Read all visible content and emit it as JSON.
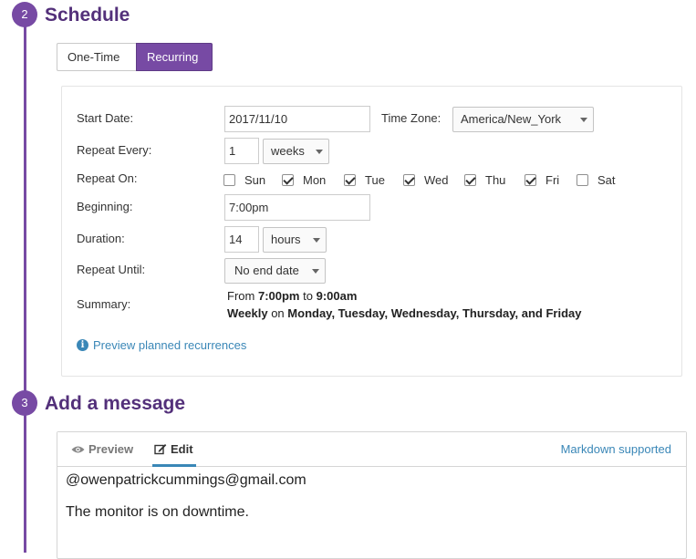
{
  "steps": {
    "schedule": {
      "number": "2",
      "title": "Schedule"
    },
    "message": {
      "number": "3",
      "title": "Add a message"
    }
  },
  "schedule_type": {
    "options": [
      "One-Time",
      "Recurring"
    ],
    "selected": "Recurring"
  },
  "form": {
    "start_date": {
      "label": "Start Date:",
      "value": "2017/11/10"
    },
    "time_zone": {
      "label": "Time Zone:",
      "value": "America/New_York"
    },
    "repeat_every": {
      "label": "Repeat Every:",
      "value": "1",
      "unit": "weeks"
    },
    "repeat_on": {
      "label": "Repeat On:",
      "days": [
        {
          "label": "Sun",
          "checked": false
        },
        {
          "label": "Mon",
          "checked": true
        },
        {
          "label": "Tue",
          "checked": true
        },
        {
          "label": "Wed",
          "checked": true
        },
        {
          "label": "Thu",
          "checked": true
        },
        {
          "label": "Fri",
          "checked": true
        },
        {
          "label": "Sat",
          "checked": false
        }
      ]
    },
    "beginning": {
      "label": "Beginning:",
      "value": "7:00pm"
    },
    "duration": {
      "label": "Duration:",
      "value": "14",
      "unit": "hours"
    },
    "repeat_until": {
      "label": "Repeat Until:",
      "value": "No end date"
    },
    "summary": {
      "label": "Summary:",
      "from_word": "From",
      "start": "7:00pm",
      "to_word": "to",
      "end": "9:00am",
      "frequency": "Weekly",
      "on_word": "on",
      "days_text": "Monday, Tuesday, Wednesday, Thursday, and Friday"
    },
    "preview_link": "Preview planned recurrences"
  },
  "editor": {
    "tabs": [
      "Preview",
      "Edit"
    ],
    "active_tab": "Edit",
    "markdown_link": "Markdown supported",
    "lines": [
      "@owenpatrickcummings@gmail.com",
      "The monitor is on downtime."
    ]
  },
  "colors": {
    "accent": "#774aa4",
    "title": "#53307a",
    "link": "#3a87b7"
  }
}
